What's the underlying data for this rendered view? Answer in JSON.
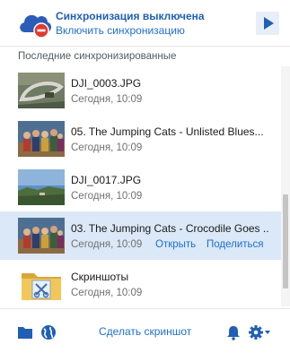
{
  "header": {
    "status_title": "Синхронизация выключена",
    "status_link": "Включить синхронизацию",
    "logo_icon": "cloud-blocked-icon",
    "play_icon": "play-icon"
  },
  "recent": {
    "title": "Последние синхронизированные",
    "items": [
      {
        "name": "DJI_0003.JPG",
        "date": "Сегодня, 10:09",
        "thumb_icon": "photo-aerial-road-thumbnail"
      },
      {
        "name": "05. The Jumping Cats - Unlisted Blues...",
        "date": "Сегодня, 10:09",
        "thumb_icon": "album-cover-thumbnail"
      },
      {
        "name": "DJI_0017.JPG",
        "date": "Сегодня, 10:09",
        "thumb_icon": "photo-landscape-thumbnail"
      },
      {
        "name": "03. The Jumping Cats - Crocodile Goes ...",
        "date": "Сегодня, 10:09",
        "thumb_icon": "album-cover-thumbnail",
        "open_label": "Открыть",
        "share_label": "Поделиться"
      },
      {
        "name": "Скриншоты",
        "date": "Сегодня, 10:09",
        "thumb_icon": "folder-icon"
      }
    ]
  },
  "footer": {
    "screenshot_label": "Сделать скриншот",
    "icons": [
      "folder-icon",
      "globe-icon",
      "bell-icon",
      "gear-icon"
    ]
  },
  "colors": {
    "accent": "#1f6fd0",
    "selected_row": "#dbe8f7",
    "blocked_badge": "#e03a2f"
  }
}
